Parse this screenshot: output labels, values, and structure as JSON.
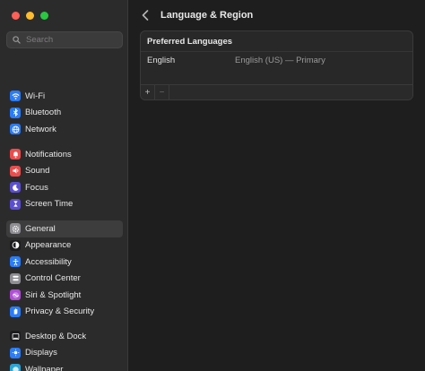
{
  "window": {
    "traffic_lights": [
      {
        "name": "close-button",
        "color": "#fe5f57"
      },
      {
        "name": "minimize-button",
        "color": "#febc2e"
      },
      {
        "name": "zoom-button",
        "color": "#28c840"
      }
    ]
  },
  "search": {
    "placeholder": "Search"
  },
  "sidebar": {
    "groups": [
      [
        {
          "label": "Wi-Fi",
          "icon": "wifi-icon",
          "color": "#2b7cf7"
        },
        {
          "label": "Bluetooth",
          "icon": "bluetooth-icon",
          "color": "#2b7cf7"
        },
        {
          "label": "Network",
          "icon": "globe-icon",
          "color": "#2b7cf7"
        }
      ],
      [
        {
          "label": "Notifications",
          "icon": "bell-icon",
          "color": "#eb4d4d"
        },
        {
          "label": "Sound",
          "icon": "speaker-icon",
          "color": "#eb4d4d"
        },
        {
          "label": "Focus",
          "icon": "moon-icon",
          "color": "#5b4fd1"
        },
        {
          "label": "Screen Time",
          "icon": "hourglass-icon",
          "color": "#5b4fd1"
        }
      ],
      [
        {
          "label": "General",
          "icon": "gear-icon",
          "color": "#8e8e93",
          "selected": true
        },
        {
          "label": "Appearance",
          "icon": "appearance-icon",
          "color": "#1c1c1e"
        },
        {
          "label": "Accessibility",
          "icon": "accessibility-icon",
          "color": "#2b7cf7"
        },
        {
          "label": "Control Center",
          "icon": "control-center-icon",
          "color": "#8e8e93"
        },
        {
          "label": "Siri & Spotlight",
          "icon": "siri-icon",
          "color": "#b04fd6"
        },
        {
          "label": "Privacy & Security",
          "icon": "hand-icon",
          "color": "#2b7cf7"
        }
      ],
      [
        {
          "label": "Desktop & Dock",
          "icon": "dock-icon",
          "color": "#1c1c1e"
        },
        {
          "label": "Displays",
          "icon": "sun-icon",
          "color": "#2b7cf7"
        },
        {
          "label": "Wallpaper",
          "icon": "wallpaper-icon",
          "color": "#2ba6d8"
        }
      ]
    ]
  },
  "header": {
    "title": "Language & Region"
  },
  "preferred_languages": {
    "title": "Preferred Languages",
    "rows": [
      {
        "language": "English",
        "detail": "English (US) — Primary"
      }
    ],
    "add_label": "+",
    "remove_label": "−"
  }
}
